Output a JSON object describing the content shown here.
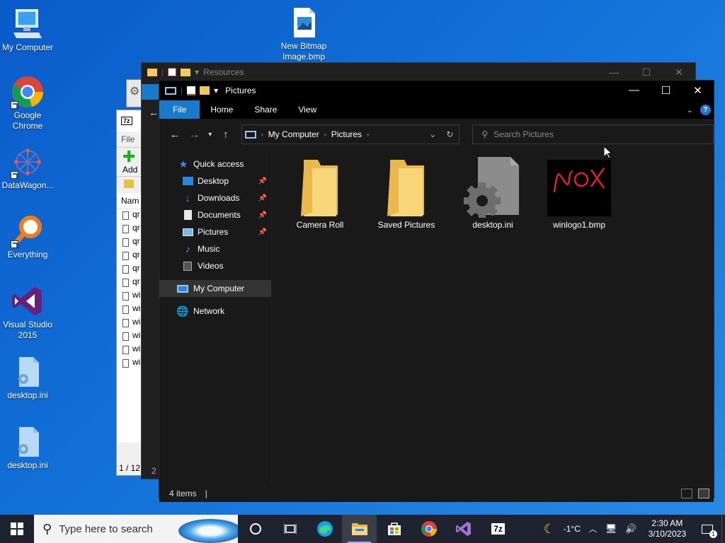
{
  "desktop": {
    "icons": [
      {
        "label": "My Computer"
      },
      {
        "label": "Google Chrome"
      },
      {
        "label": "DataWagon..."
      },
      {
        "label": "Everything"
      },
      {
        "label": "Visual Studio 2015"
      },
      {
        "label": "desktop.ini"
      },
      {
        "label": "desktop.ini"
      },
      {
        "label": "New Bitmap Image.bmp"
      }
    ]
  },
  "background_windows": {
    "resources_title": "Resources",
    "sevenzip": {
      "menu_file": "File",
      "add_label": "Add",
      "column_name": "Nam",
      "rows": [
        "qr",
        "qr",
        "qr",
        "qr",
        "qr",
        "qr",
        "wi",
        "wi",
        "wi",
        "wi",
        "wi",
        "wi"
      ],
      "status": "1 / 12",
      "status2": "2 i"
    }
  },
  "explorer": {
    "title": "Pictures",
    "ribbon": {
      "tabs": [
        "File",
        "Home",
        "Share",
        "View"
      ]
    },
    "address": {
      "crumbs": [
        "My Computer",
        "Pictures"
      ]
    },
    "search": {
      "placeholder": "Search Pictures"
    },
    "sidebar": {
      "items": [
        {
          "label": "Quick access",
          "icon": "star-icon",
          "pinned": false
        },
        {
          "label": "Desktop",
          "icon": "desktop-folder-icon",
          "pinned": true
        },
        {
          "label": "Downloads",
          "icon": "download-icon",
          "pinned": true
        },
        {
          "label": "Documents",
          "icon": "documents-icon",
          "pinned": true
        },
        {
          "label": "Pictures",
          "icon": "pictures-icon",
          "pinned": true
        },
        {
          "label": "Music",
          "icon": "music-icon",
          "pinned": false
        },
        {
          "label": "Videos",
          "icon": "videos-icon",
          "pinned": false
        },
        {
          "label": "My Computer",
          "icon": "computer-icon",
          "pinned": false
        },
        {
          "label": "Network",
          "icon": "network-icon",
          "pinned": false
        }
      ]
    },
    "files": [
      {
        "name": "Camera Roll",
        "type": "folder"
      },
      {
        "name": "Saved Pictures",
        "type": "folder"
      },
      {
        "name": "desktop.ini",
        "type": "ini"
      },
      {
        "name": "winlogo1.bmp",
        "type": "bmp"
      }
    ],
    "status": {
      "count": "4 items"
    }
  },
  "taskbar": {
    "search_placeholder": "Type here to search",
    "weather": "-1°C",
    "time": "2:30 AM",
    "date": "3/10/2023",
    "notification_count": "1"
  },
  "colors": {
    "accent": "#1979ca",
    "folder": "#f3c95c",
    "desktop_bg": "#1271d8"
  }
}
